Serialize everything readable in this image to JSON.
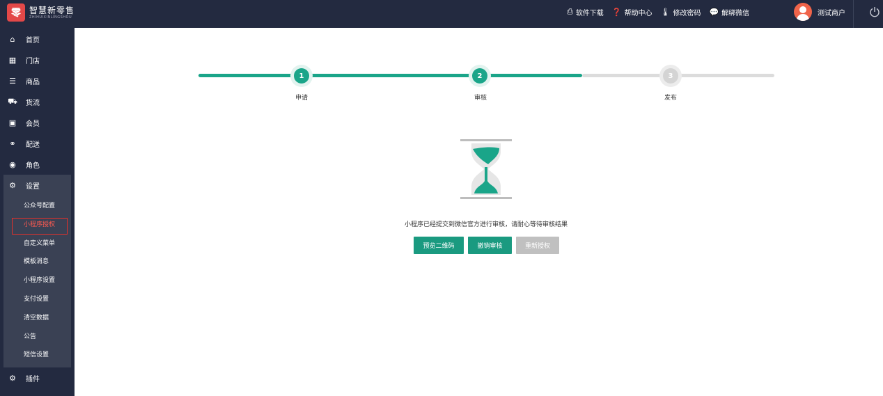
{
  "brand": {
    "logo_char": "零",
    "title": "智慧新零售",
    "subtitle": "ZHIHUIXINLINGSHOU"
  },
  "header": {
    "links": [
      {
        "label": "软件下载",
        "icon": "printer-icon"
      },
      {
        "label": "帮助中心",
        "icon": "help-circle-icon"
      },
      {
        "label": "修改密码",
        "icon": "thermometer-icon"
      },
      {
        "label": "解绑微信",
        "icon": "chat-bubbles-icon"
      }
    ],
    "user_name": "测试商户"
  },
  "sidebar": {
    "items": [
      {
        "label": "首页",
        "icon": "home-icon"
      },
      {
        "label": "门店",
        "icon": "building-icon"
      },
      {
        "label": "商品",
        "icon": "list-icon"
      },
      {
        "label": "货流",
        "icon": "truck-icon"
      },
      {
        "label": "会员",
        "icon": "id-card-icon"
      },
      {
        "label": "配送",
        "icon": "motorcycle-icon"
      },
      {
        "label": "角色",
        "icon": "user-circle-icon"
      },
      {
        "label": "设置",
        "icon": "gear-icon"
      }
    ],
    "submenu": [
      "公众号配置",
      "小程序授权",
      "自定义菜单",
      "模板消息",
      "小程序设置",
      "支付设置",
      "清空数据",
      "公告",
      "短信设置"
    ],
    "plugin_label": "插件",
    "plugin_icon": "gears-icon"
  },
  "steps": [
    {
      "number": "1",
      "label": "申请",
      "state": "done"
    },
    {
      "number": "2",
      "label": "审核",
      "state": "done"
    },
    {
      "number": "3",
      "label": "发布",
      "state": "todo"
    }
  ],
  "status_icon": "hourglass-icon",
  "message": "小程序已经提交到微信官方进行审核，请耐心等待审核结果",
  "buttons": {
    "preview_qr": "预览二维码",
    "revoke_review": "撤销审核",
    "reauthorize": "重新授权"
  },
  "colors": {
    "sidebar": "#232a40",
    "accent": "#1aa589",
    "highlight": "#e8302a"
  }
}
